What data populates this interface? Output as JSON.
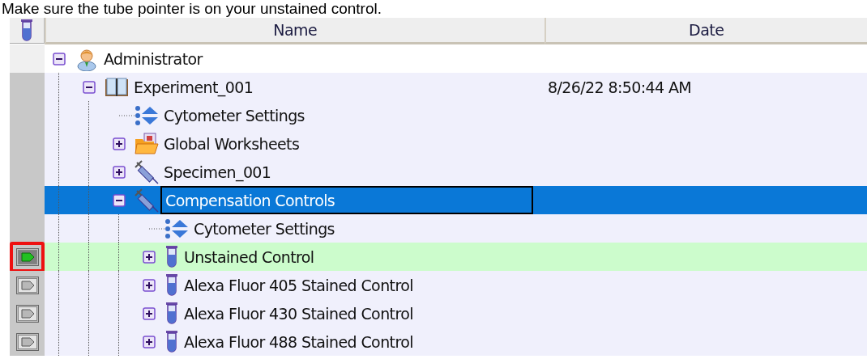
{
  "instruction": "Make sure the tube pointer is on your unstained control.",
  "columns": [
    "Name",
    "Date"
  ],
  "tree": [
    {
      "name": "Administrator",
      "kind": "person",
      "expanded": true,
      "selected": false,
      "children": [
        {
          "name": "Experiment_001",
          "kind": "experiment",
          "date": "8/26/22 8:50:44 AM",
          "expanded": true,
          "selected": false,
          "children": [
            {
              "name": "Cytometer Settings",
              "kind": "settings",
              "selected": false
            },
            {
              "name": "Global Worksheets",
              "kind": "worksheets",
              "expanded": false,
              "selected": false
            },
            {
              "name": "Specimen_001",
              "kind": "specimen",
              "expanded": false,
              "selected": false
            },
            {
              "name": "Compensation Controls",
              "kind": "specimen",
              "expanded": true,
              "selected": true,
              "children": [
                {
                  "name": "Cytometer Settings",
                  "kind": "settings",
                  "selected": false
                },
                {
                  "name": "Unstained Control",
                  "kind": "tube",
                  "expanded": false,
                  "selected": false,
                  "pointer": {
                    "current": true,
                    "highlighted": true
                  }
                },
                {
                  "name": "Alexa Fluor 405 Stained Control",
                  "kind": "tube",
                  "expanded": false,
                  "selected": false,
                  "pointer": {
                    "current": false,
                    "highlighted": false
                  }
                },
                {
                  "name": "Alexa Fluor 430 Stained Control",
                  "kind": "tube",
                  "expanded": false,
                  "selected": false,
                  "pointer": {
                    "current": false,
                    "highlighted": false
                  }
                },
                {
                  "name": "Alexa Fluor 488 Stained Control",
                  "kind": "tube",
                  "expanded": false,
                  "selected": false,
                  "pointer": {
                    "current": false,
                    "highlighted": false
                  }
                }
              ]
            }
          ]
        }
      ]
    }
  ]
}
